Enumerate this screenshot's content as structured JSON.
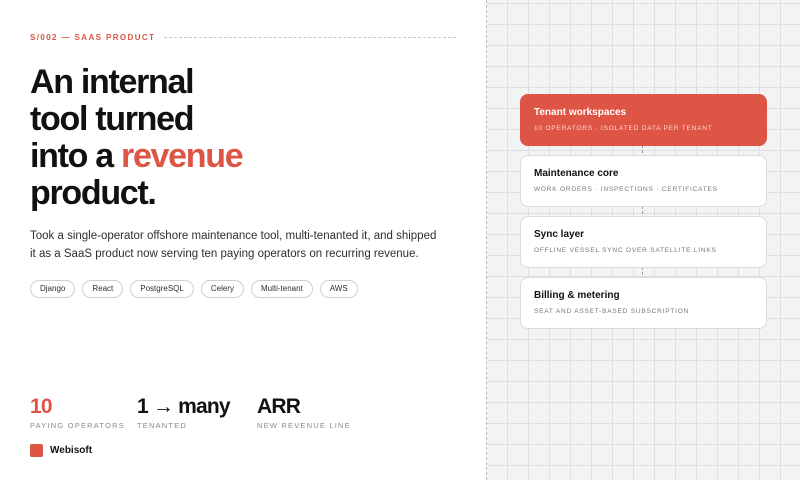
{
  "eyebrow": "S/002 — SAAS PRODUCT",
  "headline": {
    "line1": "An internal",
    "line2": "tool turned",
    "line3_prefix": "into a ",
    "line3_accent": "revenue",
    "line4": "product."
  },
  "description": "Took a single-operator offshore maintenance tool, multi-tenanted it, and shipped it as a SaaS product now serving ten paying operators on recurring revenue.",
  "tags": [
    "Django",
    "React",
    "PostgreSQL",
    "Celery",
    "Multi-tenant",
    "AWS"
  ],
  "stats": [
    {
      "value": "10",
      "label": "PAYING OPERATORS"
    },
    {
      "value": "1 → many",
      "label": "TENANTED"
    },
    {
      "value": "ARR",
      "label": "NEW REVENUE LINE"
    }
  ],
  "brand": {
    "name": "Webisoft"
  },
  "architecture": [
    {
      "title": "Tenant workspaces",
      "subtitle": "10 OPERATORS · ISOLATED DATA PER TENANT"
    },
    {
      "title": "Maintenance core",
      "subtitle": "WORK ORDERS · INSPECTIONS · CERTIFICATES"
    },
    {
      "title": "Sync layer",
      "subtitle": "OFFLINE VESSEL SYNC OVER SATELLITE LINKS"
    },
    {
      "title": "Billing & metering",
      "subtitle": "SEAT AND ASSET-BASED SUBSCRIPTION"
    }
  ],
  "colors": {
    "accent": "#de5445",
    "text": "#111111",
    "muted": "#8a8a8a",
    "grid_bg": "#f3f3f4"
  }
}
